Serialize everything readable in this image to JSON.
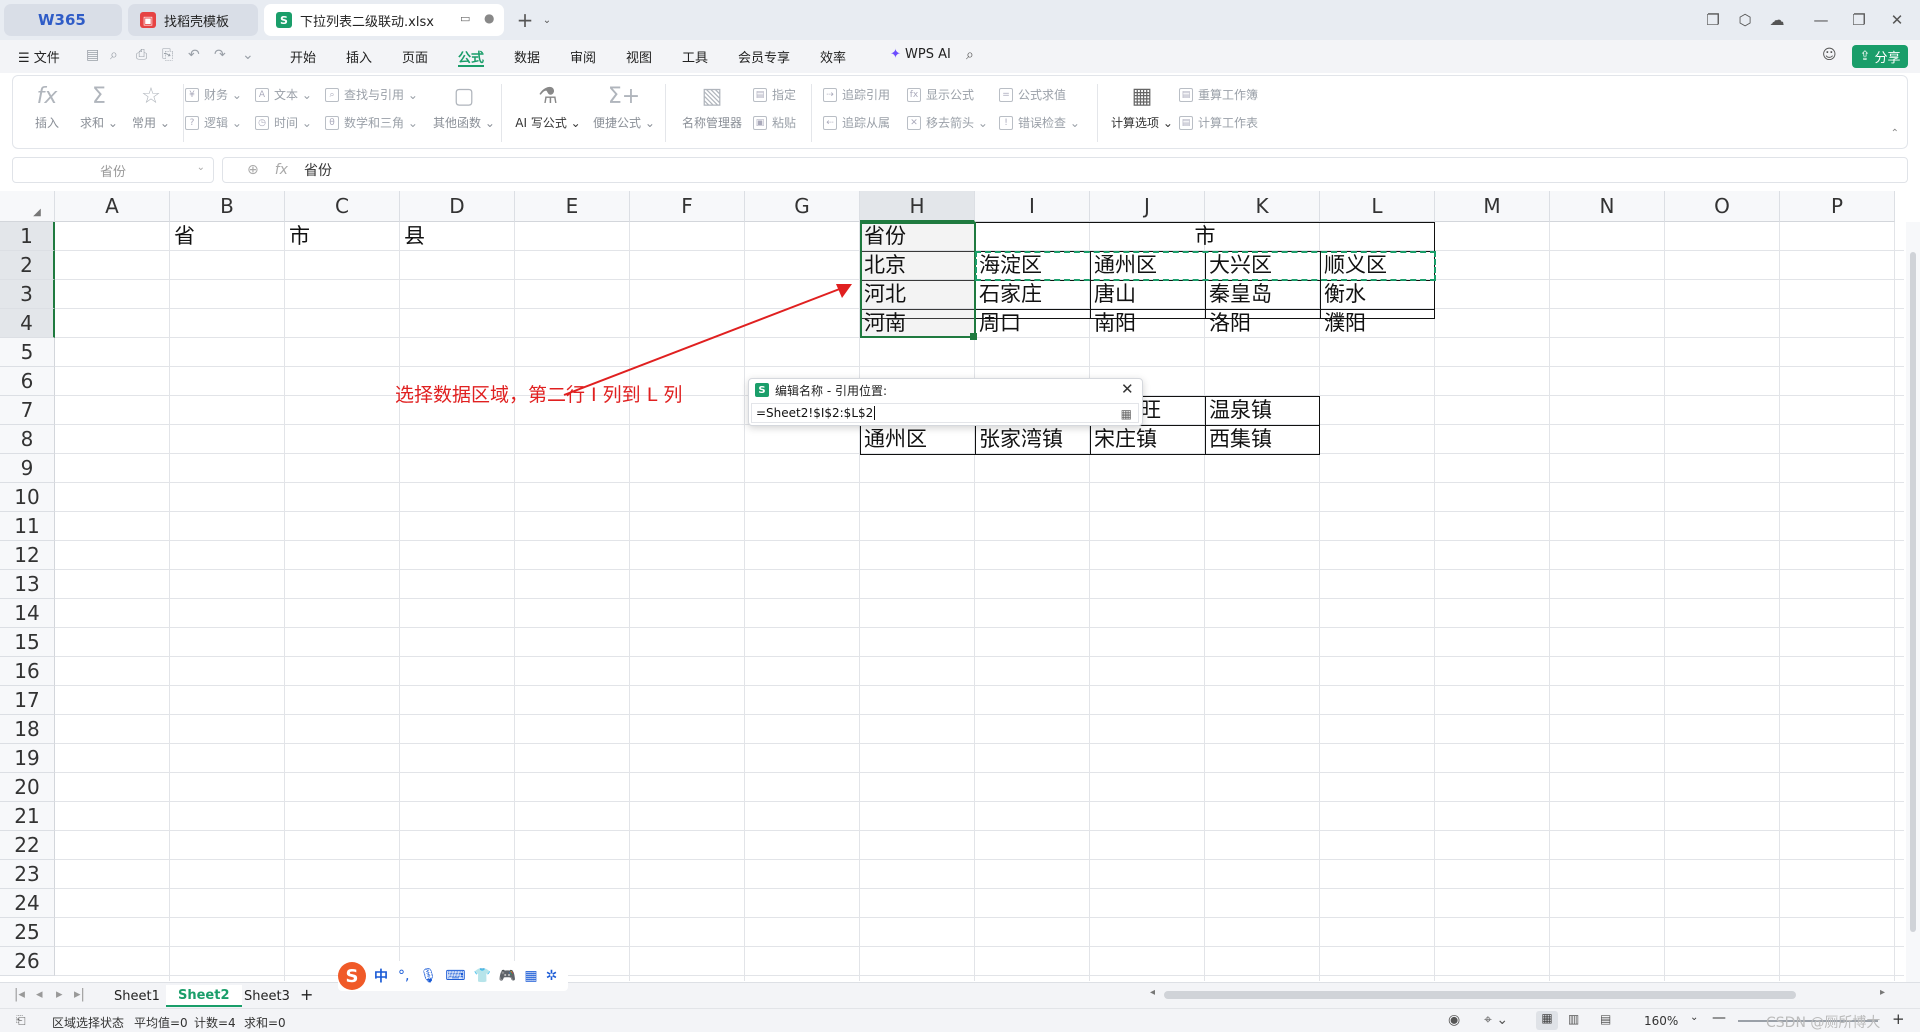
{
  "tabs": [
    {
      "label": "W365"
    },
    {
      "label": "找稻壳模板"
    },
    {
      "label": "下拉列表二级联动.xlsx"
    }
  ],
  "menu": {
    "file": "文件",
    "items": [
      "开始",
      "插入",
      "页面",
      "公式",
      "数据",
      "审阅",
      "视图",
      "工具",
      "会员专享",
      "效率"
    ],
    "active": "公式",
    "wps_ai": "WPS AI",
    "share": "分享"
  },
  "ribbon": {
    "insert": "插入",
    "sum": "求和",
    "common": "常用",
    "finance": "财务",
    "text": "文本",
    "lookup": "查找与引用",
    "logic": "逻辑",
    "time": "时间",
    "math": "数学和三角",
    "other": "其他函数",
    "ai_formula": "AI 写公式",
    "quick_formula": "便捷公式",
    "name_manager": "名称管理器",
    "specify": "指定",
    "paste": "粘贴",
    "trace_prec": "追踪引用",
    "show_formula": "显示公式",
    "eval_formula": "公式求值",
    "trace_dep": "追踪从属",
    "remove_arrows": "移去箭头",
    "error_check": "错误检查",
    "calc_options": "计算选项",
    "recalc_book": "重算工作簿",
    "calc_sheet": "计算工作表"
  },
  "formula_bar": {
    "name_box": "省份",
    "fx": "fx",
    "content": "省份"
  },
  "columns": [
    "A",
    "B",
    "C",
    "D",
    "E",
    "F",
    "G",
    "H",
    "I",
    "J",
    "K",
    "L",
    "M",
    "N",
    "O",
    "P"
  ],
  "rows": [
    "1",
    "2",
    "3",
    "4",
    "5",
    "6",
    "7",
    "8",
    "9",
    "10",
    "11",
    "12",
    "13",
    "14",
    "15",
    "16",
    "17",
    "18",
    "19",
    "20",
    "21",
    "22",
    "23",
    "24",
    "25",
    "26"
  ],
  "cells": {
    "B1": "省",
    "C1": "市",
    "D1": "县",
    "H1": "省份",
    "I1": "市",
    "H2": "北京",
    "I2": "海淀区",
    "J2": "通州区",
    "K2": "大兴区",
    "L2": "顺义区",
    "H3": "河北",
    "I3": "石家庄",
    "J3": "唐山",
    "K3": "秦皇岛",
    "L3": "衡水",
    "H4": "河南",
    "I4": "周口",
    "J4": "南阳",
    "K4": "洛阳",
    "L4": "濮阳",
    "J7": "旺",
    "K7": "温泉镇",
    "H8": "通州区",
    "I8": "张家湾镇",
    "J8": "宋庄镇",
    "K8": "西集镇"
  },
  "annotation": "选择数据区域，第二行 I 列到 L 列",
  "dialog": {
    "title": "编辑名称 - 引用位置:",
    "value": "=Sheet2!$I$2:$L$2"
  },
  "sheets": [
    "Sheet1",
    "Sheet2",
    "Sheet3"
  ],
  "active_sheet": "Sheet2",
  "ime": [
    "中",
    "°,"
  ],
  "status": {
    "mode": "区域选择状态",
    "avg": "平均值=0",
    "count": "计数=4",
    "sum": "求和=0",
    "zoom": "160%",
    "watermark": "CSDN @厕所博大"
  },
  "colors": {
    "accent": "#1a9e6a",
    "annotation": "#e02020",
    "selection": "#1f7a3f"
  }
}
